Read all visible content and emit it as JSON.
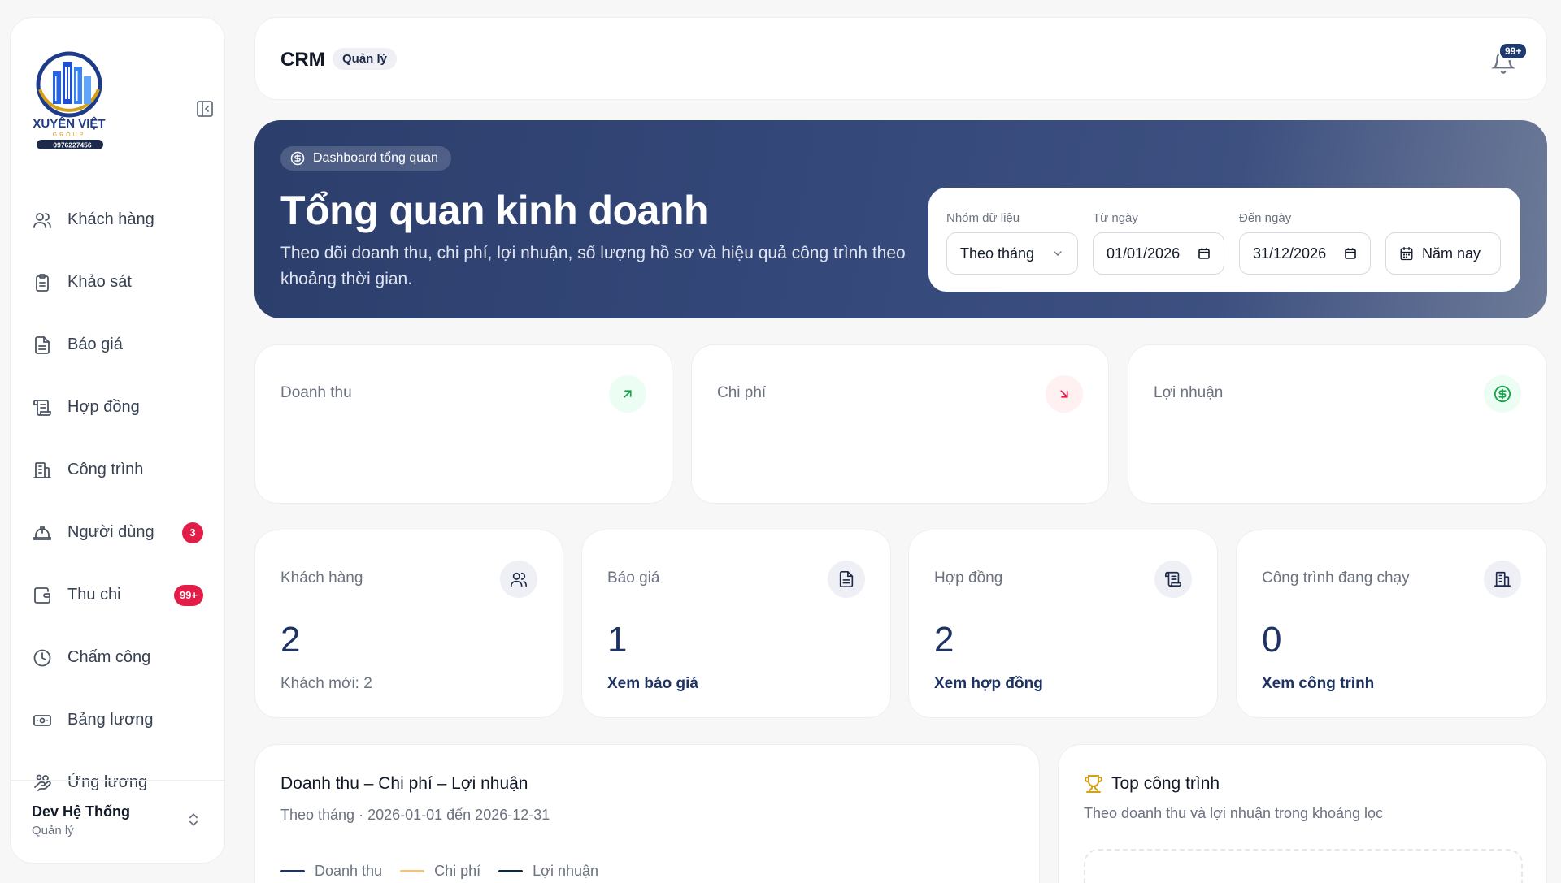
{
  "sidebar": {
    "logo_text": "XUYÊN VIỆT",
    "logo_sub": "GROUP",
    "logo_phone": "0976227456",
    "items": [
      {
        "label": "Khách hàng"
      },
      {
        "label": "Khảo sát"
      },
      {
        "label": "Báo giá"
      },
      {
        "label": "Hợp đồng"
      },
      {
        "label": "Công trình"
      },
      {
        "label": "Người dùng",
        "badge": "3"
      },
      {
        "label": "Thu chi",
        "badge": "99+"
      },
      {
        "label": "Chấm công"
      },
      {
        "label": "Bảng lương"
      },
      {
        "label": "Ứng lương"
      }
    ],
    "user": {
      "name": "Dev Hệ Thống",
      "role": "Quản lý"
    }
  },
  "topbar": {
    "title": "CRM",
    "role_pill": "Quản lý",
    "notification_badge": "99+"
  },
  "hero": {
    "pill": "Dashboard tổng quan",
    "title": "Tổng quan kinh doanh",
    "subtitle": "Theo dõi doanh thu, chi phí, lợi nhuận, số lượng hồ sơ và hiệu quả công trình theo khoảng thời gian.",
    "filters": {
      "group_label": "Nhóm dữ liệu",
      "group_value": "Theo tháng",
      "from_label": "Từ ngày",
      "from_value": "01/01/2026",
      "to_label": "Đến ngày",
      "to_value": "31/12/2026",
      "preset_button": "Năm nay"
    }
  },
  "kpis": [
    {
      "label": "Doanh thu",
      "icon": "arrow-up-right-icon",
      "color": "#16a34a",
      "bg": "#ecfdf3"
    },
    {
      "label": "Chi phí",
      "icon": "arrow-down-right-icon",
      "color": "#e11d48",
      "bg": "#fff1f2"
    },
    {
      "label": "Lợi nhuận",
      "icon": "dollar-circle-icon",
      "color": "#16a34a",
      "bg": "#ecfdf3"
    }
  ],
  "stats": [
    {
      "label": "Khách hàng",
      "value": "2",
      "foot": "Khách mới: 2"
    },
    {
      "label": "Báo giá",
      "value": "1",
      "foot": "Xem báo giá"
    },
    {
      "label": "Hợp đồng",
      "value": "2",
      "foot": "Xem hợp đồng"
    },
    {
      "label": "Công trình đang chạy",
      "value": "0",
      "foot": "Xem công trình"
    }
  ],
  "revenue_panel": {
    "title": "Doanh thu – Chi phí – Lợi nhuận",
    "subtitle": "Theo tháng · 2026-01-01 đến 2026-12-31",
    "legend": [
      {
        "name": "Doanh thu",
        "color": "#1e3364"
      },
      {
        "name": "Chi phí",
        "color": "#f0c27b"
      },
      {
        "name": "Lợi nhuận",
        "color": "#0f2a3f"
      }
    ]
  },
  "top_panel": {
    "title": "Top công trình",
    "subtitle": "Theo doanh thu và lợi nhuận trong khoảng lọc"
  }
}
